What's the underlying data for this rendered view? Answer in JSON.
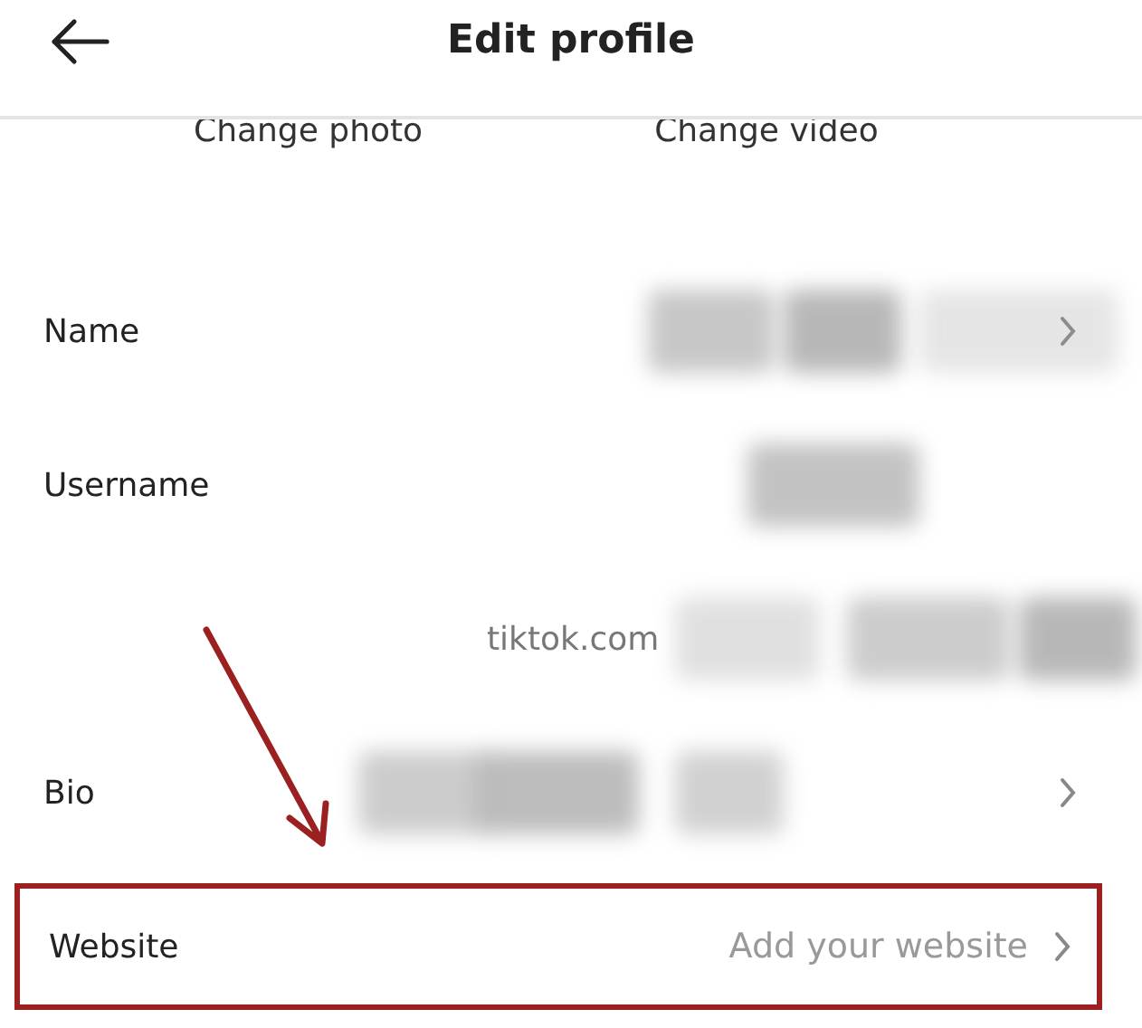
{
  "header": {
    "title": "Edit profile"
  },
  "change_links": [
    "Change photo",
    "Change video"
  ],
  "fields": [
    {
      "kind": "redacted",
      "label": "Name",
      "chevron": true,
      "highlighted": false
    },
    {
      "kind": "redacted",
      "label": "Username",
      "chevron": false,
      "highlighted": false
    },
    {
      "kind": "link",
      "prefix": "tiktok.com",
      "chevron": false,
      "highlighted": false
    },
    {
      "kind": "redacted",
      "label": "Bio",
      "chevron": true,
      "highlighted": false
    },
    {
      "kind": "placeholder",
      "label": "Website",
      "placeholder": "Add your website",
      "chevron": true,
      "highlighted": true
    }
  ]
}
